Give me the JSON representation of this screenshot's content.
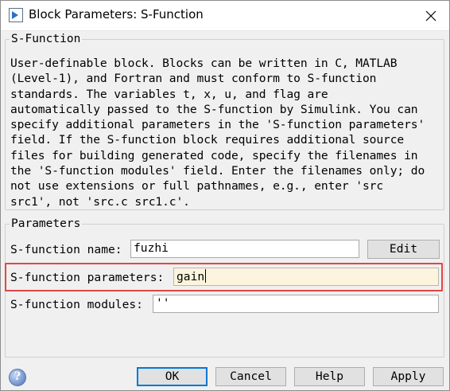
{
  "window": {
    "title": "Block Parameters: S-Function",
    "icon": "simulink-block-icon",
    "close_icon": "close-icon"
  },
  "sfunction_group": {
    "title": "S-Function",
    "description": "User-definable block.  Blocks can be written in C, MATLAB\n(Level-1), and Fortran and must conform to S-function\nstandards.  The variables t, x, u, and flag are\nautomatically passed to the S-function by Simulink.  You can\nspecify additional parameters in the 'S-function parameters'\nfield. If the S-function block requires additional source\nfiles for building generated code, specify the filenames in\nthe 'S-function modules' field. Enter the filenames only; do\nnot use extensions or full pathnames, e.g., enter 'src\nsrc1', not 'src.c src1.c'."
  },
  "parameters_group": {
    "title": "Parameters",
    "name_label": "S-function name:",
    "name_value": "fuzhi",
    "edit_button": "Edit",
    "params_label": "S-function parameters:",
    "params_value": "gain",
    "modules_label": "S-function modules:",
    "modules_value": "''"
  },
  "footer": {
    "help_icon": "help-icon",
    "ok": "OK",
    "cancel": "Cancel",
    "help": "Help",
    "apply": "Apply"
  },
  "colors": {
    "highlight_border": "#e34545",
    "active_field_bg": "#fcf4dc",
    "default_button_border": "#0078d7"
  }
}
